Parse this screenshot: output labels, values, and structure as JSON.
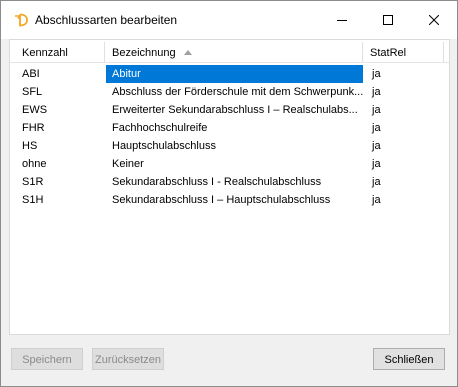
{
  "window": {
    "title": "Abschlussarten bearbeiten"
  },
  "table": {
    "columns": [
      "Kennzahl",
      "Bezeichnung",
      "StatRel"
    ],
    "sorted_column": "Bezeichnung",
    "rows": [
      {
        "kennzahl": "ABI",
        "bezeichnung": "Abitur",
        "statrel": "ja",
        "selected": true
      },
      {
        "kennzahl": "SFL",
        "bezeichnung": "Abschluss der Förderschule mit dem Schwerpunk...",
        "statrel": "ja"
      },
      {
        "kennzahl": "EWS",
        "bezeichnung": "Erweiterter Sekundarabschluss I – Realschulabs...",
        "statrel": "ja"
      },
      {
        "kennzahl": "FHR",
        "bezeichnung": "Fachhochschulreife",
        "statrel": "ja"
      },
      {
        "kennzahl": "HS",
        "bezeichnung": "Hauptschulabschluss",
        "statrel": "ja"
      },
      {
        "kennzahl": "ohne",
        "bezeichnung": "Keiner",
        "statrel": "ja"
      },
      {
        "kennzahl": "S1R",
        "bezeichnung": "Sekundarabschluss I - Realschulabschluss",
        "statrel": "ja"
      },
      {
        "kennzahl": "S1H",
        "bezeichnung": "Sekundarabschluss I – Hauptschulabschluss",
        "statrel": "ja"
      }
    ]
  },
  "buttons": {
    "save": "Speichern",
    "reset": "Zurücksetzen",
    "close": "Schließen"
  },
  "icons": {
    "app": "app-logo-icon",
    "minimize": "minimize-icon",
    "maximize": "maximize-icon",
    "close": "close-icon",
    "sort": "sort-ascending-icon"
  },
  "colors": {
    "selection": "#0078d7",
    "logo": "#f5a623"
  }
}
